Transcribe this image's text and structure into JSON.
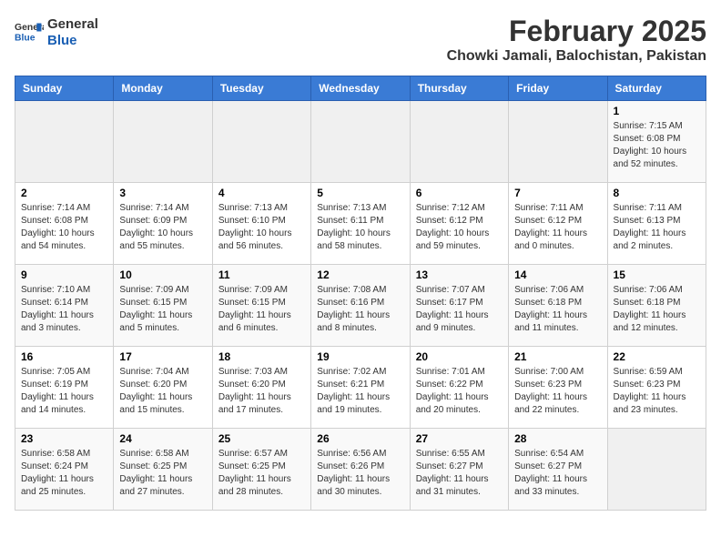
{
  "header": {
    "logo_general": "General",
    "logo_blue": "Blue",
    "month_title": "February 2025",
    "location": "Chowki Jamali, Balochistan, Pakistan"
  },
  "weekdays": [
    "Sunday",
    "Monday",
    "Tuesday",
    "Wednesday",
    "Thursday",
    "Friday",
    "Saturday"
  ],
  "weeks": [
    [
      {
        "day": "",
        "info": ""
      },
      {
        "day": "",
        "info": ""
      },
      {
        "day": "",
        "info": ""
      },
      {
        "day": "",
        "info": ""
      },
      {
        "day": "",
        "info": ""
      },
      {
        "day": "",
        "info": ""
      },
      {
        "day": "1",
        "info": "Sunrise: 7:15 AM\nSunset: 6:08 PM\nDaylight: 10 hours\nand 52 minutes."
      }
    ],
    [
      {
        "day": "2",
        "info": "Sunrise: 7:14 AM\nSunset: 6:08 PM\nDaylight: 10 hours\nand 54 minutes."
      },
      {
        "day": "3",
        "info": "Sunrise: 7:14 AM\nSunset: 6:09 PM\nDaylight: 10 hours\nand 55 minutes."
      },
      {
        "day": "4",
        "info": "Sunrise: 7:13 AM\nSunset: 6:10 PM\nDaylight: 10 hours\nand 56 minutes."
      },
      {
        "day": "5",
        "info": "Sunrise: 7:13 AM\nSunset: 6:11 PM\nDaylight: 10 hours\nand 58 minutes."
      },
      {
        "day": "6",
        "info": "Sunrise: 7:12 AM\nSunset: 6:12 PM\nDaylight: 10 hours\nand 59 minutes."
      },
      {
        "day": "7",
        "info": "Sunrise: 7:11 AM\nSunset: 6:12 PM\nDaylight: 11 hours\nand 0 minutes."
      },
      {
        "day": "8",
        "info": "Sunrise: 7:11 AM\nSunset: 6:13 PM\nDaylight: 11 hours\nand 2 minutes."
      }
    ],
    [
      {
        "day": "9",
        "info": "Sunrise: 7:10 AM\nSunset: 6:14 PM\nDaylight: 11 hours\nand 3 minutes."
      },
      {
        "day": "10",
        "info": "Sunrise: 7:09 AM\nSunset: 6:15 PM\nDaylight: 11 hours\nand 5 minutes."
      },
      {
        "day": "11",
        "info": "Sunrise: 7:09 AM\nSunset: 6:15 PM\nDaylight: 11 hours\nand 6 minutes."
      },
      {
        "day": "12",
        "info": "Sunrise: 7:08 AM\nSunset: 6:16 PM\nDaylight: 11 hours\nand 8 minutes."
      },
      {
        "day": "13",
        "info": "Sunrise: 7:07 AM\nSunset: 6:17 PM\nDaylight: 11 hours\nand 9 minutes."
      },
      {
        "day": "14",
        "info": "Sunrise: 7:06 AM\nSunset: 6:18 PM\nDaylight: 11 hours\nand 11 minutes."
      },
      {
        "day": "15",
        "info": "Sunrise: 7:06 AM\nSunset: 6:18 PM\nDaylight: 11 hours\nand 12 minutes."
      }
    ],
    [
      {
        "day": "16",
        "info": "Sunrise: 7:05 AM\nSunset: 6:19 PM\nDaylight: 11 hours\nand 14 minutes."
      },
      {
        "day": "17",
        "info": "Sunrise: 7:04 AM\nSunset: 6:20 PM\nDaylight: 11 hours\nand 15 minutes."
      },
      {
        "day": "18",
        "info": "Sunrise: 7:03 AM\nSunset: 6:20 PM\nDaylight: 11 hours\nand 17 minutes."
      },
      {
        "day": "19",
        "info": "Sunrise: 7:02 AM\nSunset: 6:21 PM\nDaylight: 11 hours\nand 19 minutes."
      },
      {
        "day": "20",
        "info": "Sunrise: 7:01 AM\nSunset: 6:22 PM\nDaylight: 11 hours\nand 20 minutes."
      },
      {
        "day": "21",
        "info": "Sunrise: 7:00 AM\nSunset: 6:23 PM\nDaylight: 11 hours\nand 22 minutes."
      },
      {
        "day": "22",
        "info": "Sunrise: 6:59 AM\nSunset: 6:23 PM\nDaylight: 11 hours\nand 23 minutes."
      }
    ],
    [
      {
        "day": "23",
        "info": "Sunrise: 6:58 AM\nSunset: 6:24 PM\nDaylight: 11 hours\nand 25 minutes."
      },
      {
        "day": "24",
        "info": "Sunrise: 6:58 AM\nSunset: 6:25 PM\nDaylight: 11 hours\nand 27 minutes."
      },
      {
        "day": "25",
        "info": "Sunrise: 6:57 AM\nSunset: 6:25 PM\nDaylight: 11 hours\nand 28 minutes."
      },
      {
        "day": "26",
        "info": "Sunrise: 6:56 AM\nSunset: 6:26 PM\nDaylight: 11 hours\nand 30 minutes."
      },
      {
        "day": "27",
        "info": "Sunrise: 6:55 AM\nSunset: 6:27 PM\nDaylight: 11 hours\nand 31 minutes."
      },
      {
        "day": "28",
        "info": "Sunrise: 6:54 AM\nSunset: 6:27 PM\nDaylight: 11 hours\nand 33 minutes."
      },
      {
        "day": "",
        "info": ""
      }
    ]
  ]
}
